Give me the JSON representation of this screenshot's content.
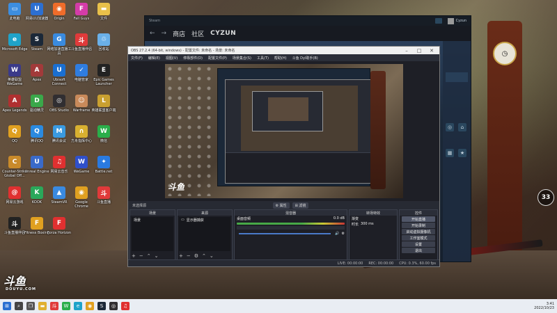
{
  "desktop": {
    "icons": [
      {
        "label": "此电脑",
        "icon": "computer-icon",
        "color": "#3d8ee0",
        "glyph": "▭"
      },
      {
        "label": "网易UU加速器",
        "icon": "uu-icon",
        "color": "#2c6fd1",
        "glyph": "U"
      },
      {
        "label": "Origin",
        "icon": "origin-icon",
        "color": "#f06c2a",
        "glyph": "◉"
      },
      {
        "label": "Fall Guys",
        "icon": "fallguys-icon",
        "color": "#d43ca8",
        "glyph": "F"
      },
      {
        "label": "文件",
        "icon": "folder-icon",
        "color": "#e8c04a",
        "glyph": "▬"
      },
      {
        "label": "Microsoft Edge",
        "icon": "edge-icon",
        "color": "#1fa3c9",
        "glyph": "e"
      },
      {
        "label": "Steam",
        "icon": "steam-icon",
        "color": "#1b2838",
        "glyph": "S"
      },
      {
        "label": "网络加速直播工具",
        "icon": "speed-icon",
        "color": "#3a8be0",
        "glyph": "G"
      },
      {
        "label": "斗鱼直播伴侣",
        "icon": "douyu-assist-icon",
        "color": "#e03a3a",
        "glyph": "斗"
      },
      {
        "label": "回收站",
        "icon": "recycle-bin-icon",
        "color": "#6ab0e8",
        "glyph": "♲"
      },
      {
        "label": "英雄联盟WeGame",
        "icon": "wegame-icon",
        "color": "#3a3a8a",
        "glyph": "W"
      },
      {
        "label": "Apex",
        "icon": "apex-icon",
        "color": "#a23a3a",
        "glyph": "A"
      },
      {
        "label": "Ubisoft Connect",
        "icon": "ubisoft-icon",
        "color": "#1a6fd1",
        "glyph": "U"
      },
      {
        "label": "电脑管家",
        "icon": "guard-icon",
        "color": "#2f7de0",
        "glyph": "✓"
      },
      {
        "label": "Epic Games Launcher",
        "icon": "epic-icon",
        "color": "#222",
        "glyph": "E"
      },
      {
        "label": "Apex Legends",
        "icon": "apex-legends-icon",
        "color": "#b03030",
        "glyph": "A"
      },
      {
        "label": "驱动精灵",
        "icon": "driver-icon",
        "color": "#3aa84a",
        "glyph": "D"
      },
      {
        "label": "OBS Studio",
        "icon": "obs-icon",
        "color": "#302e31",
        "glyph": "◎"
      },
      {
        "label": "Warframe",
        "icon": "anime-icon",
        "color": "#c98a5a",
        "glyph": "☺"
      },
      {
        "label": "英雄联盟客户端",
        "icon": "lol-icon",
        "color": "#c9a030",
        "glyph": "L"
      },
      {
        "label": "QQ",
        "icon": "qq-icon",
        "color": "#e0a020",
        "glyph": "Q"
      },
      {
        "label": "腾讯QQ",
        "icon": "qq2-icon",
        "color": "#2a8ae0",
        "glyph": "Q"
      },
      {
        "label": "腾讯会议",
        "icon": "meeting-icon",
        "color": "#3a9ae0",
        "glyph": "M"
      },
      {
        "label": "方舟指挥中心",
        "icon": "yellow-icon",
        "color": "#d8b030",
        "glyph": "∩"
      },
      {
        "label": "微信",
        "icon": "wechat-icon",
        "color": "#2aae4a",
        "glyph": "W"
      },
      {
        "label": "Counter-Strike Global Off...",
        "icon": "csgo-icon",
        "color": "#c98a2a",
        "glyph": "C"
      },
      {
        "label": "Unreal Engine",
        "icon": "unreal-icon",
        "color": "#3a6ac9",
        "glyph": "U"
      },
      {
        "label": "网易云音乐",
        "icon": "netease-icon",
        "color": "#e03030",
        "glyph": "♫"
      },
      {
        "label": "WeGame",
        "icon": "wegame2-icon",
        "color": "#3050c9",
        "glyph": "W"
      },
      {
        "label": "Battle.net",
        "icon": "battlenet-icon",
        "color": "#2a7ae0",
        "glyph": "✦"
      },
      {
        "label": "网易云游戏",
        "icon": "netease2-icon",
        "color": "#e03030",
        "glyph": "@"
      },
      {
        "label": "KOOK",
        "icon": "kook-icon",
        "color": "#2aa85a",
        "glyph": "K"
      },
      {
        "label": "SteamVR",
        "icon": "steamvr-icon",
        "color": "#3a8ae0",
        "glyph": "▲"
      },
      {
        "label": "Google Chrome",
        "icon": "chrome-icon",
        "color": "#e0a020",
        "glyph": "◉"
      },
      {
        "label": "斗鱼直播",
        "icon": "douyu-live-icon",
        "color": "#e03a3a",
        "glyph": "斗"
      },
      {
        "label": "斗鱼直播伴侣",
        "icon": "douyu-assist2-icon",
        "color": "#222",
        "glyph": "斗"
      },
      {
        "label": "Fitness Boxing",
        "icon": "fitness-icon",
        "color": "#e0a020",
        "glyph": "F"
      },
      {
        "label": "Forza Horizon",
        "icon": "forza-icon",
        "color": "#e03030",
        "glyph": "F"
      }
    ],
    "badge": "33",
    "watermark": {
      "logo": "斗鱼",
      "sub": "DOUYU.COM"
    }
  },
  "steam": {
    "nav": {
      "back": "←",
      "forward": "→",
      "store": "商店",
      "community": "社区",
      "user": "CYZUN"
    },
    "top_user": "Cyzun"
  },
  "obs": {
    "title": "OBS 27.2.4 (64-bit, windows) - 配置文件: 未命名 - 场景: 未命名",
    "menu": [
      "文件(F)",
      "编辑(E)",
      "视图(V)",
      "停靠部件(D)",
      "配置文件(P)",
      "场景集合(S)",
      "工具(T)",
      "帮助(H)",
      "斗鱼 Dyl助手(B)"
    ],
    "source_label": "未选择源",
    "toolbar_buttons": [
      "⚙ 属性",
      "⊞ 滤镜"
    ],
    "docks": {
      "scenes": {
        "title": "场景",
        "items": [
          "场景"
        ]
      },
      "sources": {
        "title": "来源",
        "items": [
          "显示器捕获"
        ]
      },
      "mixer": {
        "title": "混音器",
        "track": "桌面音频",
        "level": "0.0 dB"
      },
      "transitions": {
        "title": "转场特效",
        "type": "渐变",
        "duration_label": "时长",
        "duration": "300 ms"
      },
      "controls": {
        "title": "控件",
        "buttons": [
          "开始直播",
          "开始录制",
          "启动虚拟摄像机",
          "工作室模式",
          "设置",
          "退出"
        ]
      }
    },
    "status": {
      "live": "LIVE: 00:00:00",
      "rec": "REC: 00:00:00",
      "cpu": "CPU: 0.3%, 60.00 fps"
    }
  },
  "taskbar": {
    "time": "3:41",
    "date": "2022/10/23",
    "icons": [
      "start-icon",
      "search-icon",
      "taskview-icon",
      "explorer-icon",
      "douyu-task-icon",
      "wechat-task-icon",
      "edge-task-icon",
      "chrome-task-icon",
      "steam-task-icon",
      "obs-task-icon",
      "netease-task-icon"
    ]
  }
}
